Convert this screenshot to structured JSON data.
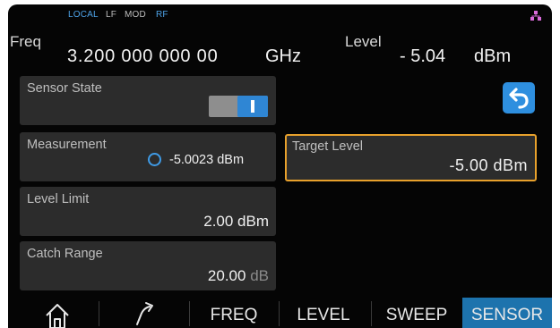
{
  "status": {
    "local": "LOCAL",
    "lf": "LF",
    "mod": "MOD",
    "rf": "RF",
    "network_icon": "network-icon"
  },
  "header": {
    "freq_label": "Freq",
    "freq_value": "3.200 000 000 00",
    "freq_unit": "GHz",
    "level_label": "Level",
    "level_value": "- 5.04",
    "level_unit": "dBm"
  },
  "sensor_state": {
    "label": "Sensor State",
    "toggle_on": true
  },
  "measurement": {
    "label": "Measurement",
    "value": "-5.0023 dBm"
  },
  "target_level": {
    "label": "Target Level",
    "value": "-5.00 dBm"
  },
  "level_limit": {
    "label": "Level Limit",
    "value": "2.00 dBm"
  },
  "catch_range": {
    "label": "Catch Range",
    "value": "20.00",
    "unit": "dB"
  },
  "back_button": {
    "icon": "back-arrow-icon"
  },
  "bottombar": {
    "home_icon": "home-icon",
    "shortcut_icon": "arrow-icon",
    "freq": "FREQ",
    "level": "LEVEL",
    "sweep": "SWEEP",
    "sensor": "SENSOR"
  },
  "colors": {
    "accent": "#2e8fdf",
    "focus_border": "#e8a12c",
    "active_tab": "#1d73ad",
    "card_bg": "#2c2c2c"
  }
}
